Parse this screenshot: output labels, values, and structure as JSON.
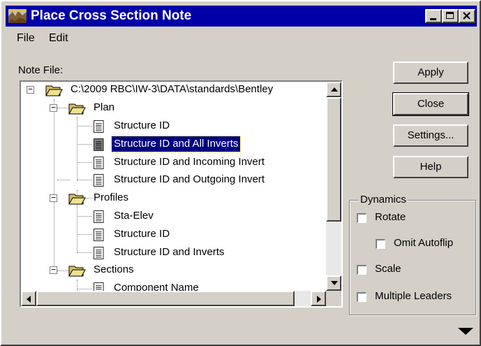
{
  "window": {
    "title": "Place Cross Section Note"
  },
  "menu": [
    {
      "label": "File"
    },
    {
      "label": "Edit"
    }
  ],
  "note_file_label": "Note File:",
  "tree": {
    "root": "C:\\2009 RBC\\IW-3\\DATA\\standards\\Bentley",
    "items": [
      {
        "label": "Plan",
        "kind": "folder"
      },
      {
        "label": "Structure ID",
        "kind": "doc"
      },
      {
        "label": "Structure ID and All Inverts",
        "kind": "doc",
        "selected": true
      },
      {
        "label": "Structure ID and Incoming Invert",
        "kind": "doc"
      },
      {
        "label": "Structure ID and Outgoing Invert",
        "kind": "doc"
      },
      {
        "label": "Profiles",
        "kind": "folder"
      },
      {
        "label": "Sta-Elev",
        "kind": "doc"
      },
      {
        "label": "Structure ID",
        "kind": "doc"
      },
      {
        "label": "Structure ID and Inverts",
        "kind": "doc"
      },
      {
        "label": "Sections",
        "kind": "folder"
      },
      {
        "label": "Component Name",
        "kind": "doc"
      }
    ]
  },
  "buttons": {
    "apply": "Apply",
    "close": "Close",
    "settings": "Settings...",
    "help": "Help"
  },
  "dynamics": {
    "title": "Dynamics",
    "rotate": "Rotate",
    "omit_autoflip": "Omit Autoflip",
    "scale": "Scale",
    "multiple_leaders": "Multiple Leaders"
  },
  "colors": {
    "title_bar": "#0000a8",
    "selection": "#000080",
    "face": "#d4d0c8"
  }
}
